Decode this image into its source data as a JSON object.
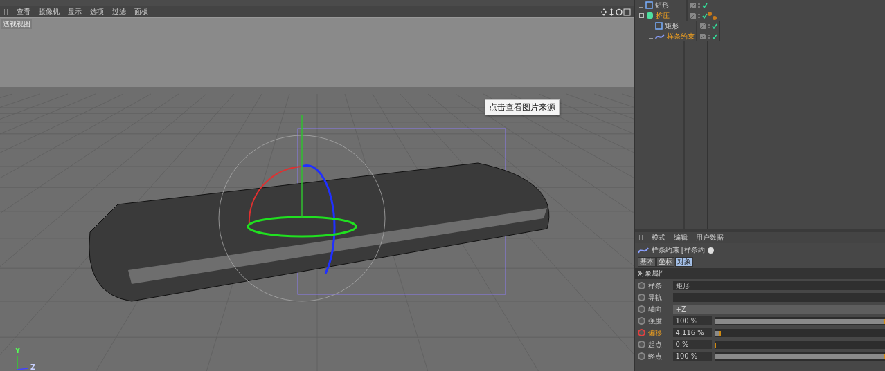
{
  "viewport_menu": [
    "查看",
    "摄像机",
    "显示",
    "选项",
    "过滤",
    "面板"
  ],
  "viewport": {
    "label": "透视视图",
    "tooltip": "点击查看图片来源",
    "axis_y": "Y",
    "axis_z": "Z"
  },
  "object_tree": [
    {
      "name": "矩形",
      "kind": "rect"
    },
    {
      "name": "挤压",
      "kind": "extrude",
      "children": [
        {
          "name": "矩形",
          "kind": "rect"
        },
        {
          "name": "样条约束",
          "kind": "spline"
        }
      ]
    }
  ],
  "attributes": {
    "menu": [
      "模式",
      "编辑",
      "用户数据"
    ],
    "title": "样条约束 [样条约",
    "tabs": [
      {
        "label": "基本",
        "selected": false
      },
      {
        "label": "坐标",
        "selected": false
      },
      {
        "label": "对象",
        "selected": true
      }
    ],
    "section": "对象属性",
    "params": [
      {
        "label": "样条",
        "kind": "link",
        "value": "矩形",
        "animated": false
      },
      {
        "label": "导轨",
        "kind": "link",
        "animated": false
      },
      {
        "label": "轴向",
        "kind": "choice",
        "value": "+Z",
        "animated": false
      },
      {
        "label": "强度",
        "kind": "slider",
        "value": "100 %",
        "level": 1,
        "animated": false
      },
      {
        "label": "偏移",
        "kind": "slider",
        "value": "4.116 %",
        "level": 0.04,
        "animated": true
      },
      {
        "label": "起点",
        "kind": "slider",
        "value": "0 %",
        "level": 0,
        "animated": false
      },
      {
        "label": "终点",
        "kind": "slider",
        "value": "100 %",
        "level": 1,
        "animated": false
      }
    ]
  }
}
